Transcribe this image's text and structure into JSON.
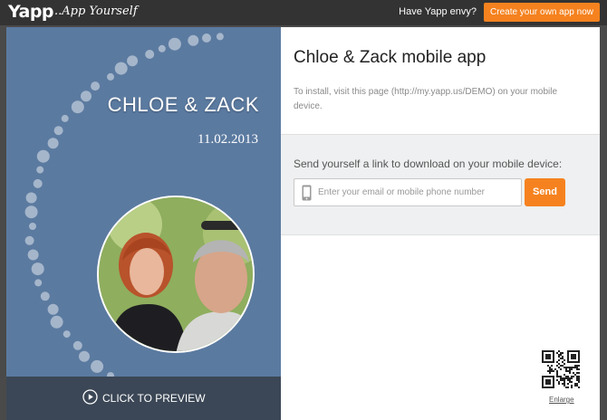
{
  "topbar": {
    "logo": "Yapp",
    "tagline": "..App Yourself",
    "envy_text": "Have Yapp envy?",
    "create_button": "Create your own app now",
    "accent": "#f5821f"
  },
  "invitation": {
    "names": "CHLOE & ZACK",
    "date": "11.02.2013",
    "preview_label": "CLICK TO PREVIEW",
    "background": "#5b7aa0"
  },
  "app": {
    "title": "Chloe & Zack mobile app",
    "install_text": "To install, visit this page (http://my.yapp.us/DEMO) on your mobile device.",
    "send_heading": "Send yourself a link to download on your mobile device:",
    "input_placeholder": "Enter your email or mobile phone number",
    "send_button": "Send",
    "enlarge_label": "Enlarge"
  },
  "icons": [
    "phone-icon",
    "play-icon",
    "qr-code-icon"
  ]
}
